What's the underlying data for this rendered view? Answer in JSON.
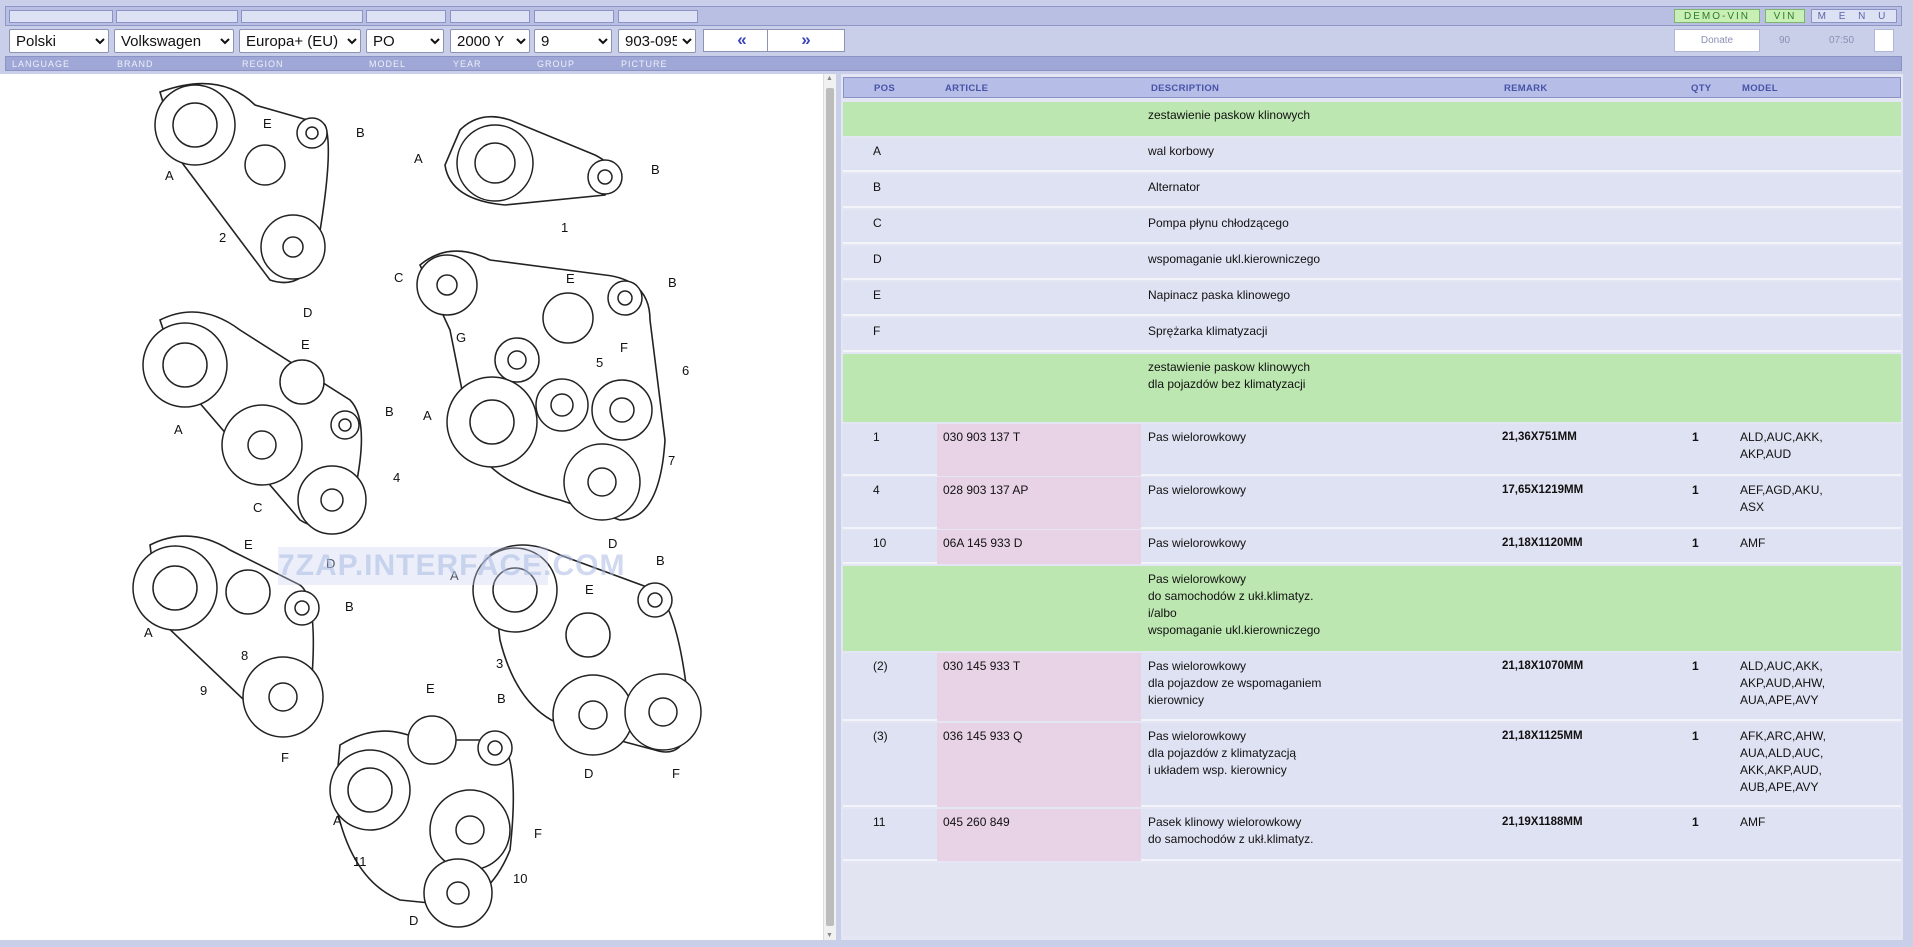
{
  "header": {
    "demo_vin": "DEMO-VIN",
    "vin": "VIN",
    "menu": "M E N U",
    "donate": "Donate",
    "counter": "90",
    "time": "07:50"
  },
  "selectors": {
    "language": "Polski",
    "brand": "Volkswagen",
    "region": "Europa+ (EU)",
    "model": "PO",
    "year": "2000  Y",
    "group": "9",
    "picture": "903-095"
  },
  "labels": {
    "language": "LANGUAGE",
    "brand": "BRAND",
    "region": "REGION",
    "model": "MODEL",
    "year": "YEAR",
    "group": "GROUP",
    "picture": "PICTURE"
  },
  "nav": {
    "prev": "«",
    "next": "»"
  },
  "watermark": "7ZAP.INTERFACE.COM",
  "table": {
    "headers": {
      "pos": "POS",
      "article": "ARTICLE",
      "description": "DESCRIPTION",
      "remark": "REMARK",
      "qty": "QTY",
      "model": "MODEL"
    },
    "rows": [
      {
        "type": "desc",
        "pos": "",
        "article": "",
        "description": "zestawienie paskow klinowych",
        "remark": "",
        "qty": "",
        "model": ""
      },
      {
        "type": "item",
        "pos": "A",
        "article": "",
        "description": "wal korbowy",
        "remark": "",
        "qty": "",
        "model": ""
      },
      {
        "type": "item",
        "pos": "B",
        "article": "",
        "description": "Alternator",
        "remark": "",
        "qty": "",
        "model": ""
      },
      {
        "type": "item",
        "pos": "C",
        "article": "",
        "description": "Pompa płynu chłodzącego",
        "remark": "",
        "qty": "",
        "model": ""
      },
      {
        "type": "item",
        "pos": "D",
        "article": "",
        "description": "wspomaganie ukl.kierowniczego",
        "remark": "",
        "qty": "",
        "model": ""
      },
      {
        "type": "item",
        "pos": "E",
        "article": "",
        "description": "Napinacz paska klinowego",
        "remark": "",
        "qty": "",
        "model": ""
      },
      {
        "type": "item",
        "pos": "F",
        "article": "",
        "description": "Sprężarka klimatyzacji",
        "remark": "",
        "qty": "",
        "model": ""
      },
      {
        "type": "desc",
        "pos": "",
        "article": "",
        "description": "zestawienie paskow klinowych\ndla pojazdów bez klimatyzacji",
        "remark": "",
        "qty": "",
        "model": ""
      },
      {
        "type": "item",
        "pos": "1",
        "article": "030 903 137 T",
        "description": "Pas wielorowkowy",
        "remark": "21,36X751MM",
        "qty": "1",
        "model": "ALD,AUC,AKK,\nAKP,AUD"
      },
      {
        "type": "item",
        "pos": "4",
        "article": "028 903 137 AP",
        "description": "Pas wielorowkowy",
        "remark": "17,65X1219MM",
        "qty": "1",
        "model": "AEF,AGD,AKU,\nASX"
      },
      {
        "type": "item",
        "pos": "10",
        "article": "06A 145 933 D",
        "description": "Pas wielorowkowy",
        "remark": "21,18X1120MM",
        "qty": "1",
        "model": "AMF"
      },
      {
        "type": "desc",
        "pos": "",
        "article": "",
        "description": "Pas wielorowkowy\ndo samochodów z ukł.klimatyz.\ni/albo\nwspomaganie ukl.kierowniczego",
        "remark": "",
        "qty": "",
        "model": ""
      },
      {
        "type": "item",
        "pos": "(2)",
        "article": "030 145 933 T",
        "description": "Pas wielorowkowy\ndla pojazdow ze wspomaganiem\nkierownicy",
        "remark": "21,18X1070MM",
        "qty": "1",
        "model": "ALD,AUC,AKK,\nAKP,AUD,AHW,\nAUA,APE,AVY"
      },
      {
        "type": "item",
        "pos": "(3)",
        "article": "036 145 933 Q",
        "description": "Pas wielorowkowy\ndla pojazdów z klimatyzacją\ni układem wsp. kierownicy",
        "remark": "21,18X1125MM",
        "qty": "1",
        "model": "AFK,ARC,AHW,\nAUA,ALD,AUC,\nAKK,AKP,AUD,\nAUB,APE,AVY"
      },
      {
        "type": "item",
        "pos": "11",
        "article": "045 260 849",
        "description": "Pasek klinowy wielorowkowy\ndo samochodów z ukł.klimatyz.",
        "remark": "21,19X1188MM",
        "qty": "1",
        "model": "AMF"
      }
    ]
  },
  "diagram": {
    "callouts": [
      "A",
      "B",
      "C",
      "D",
      "E",
      "F",
      "G",
      "1",
      "2",
      "3",
      "4",
      "5",
      "6",
      "7",
      "8",
      "9",
      "10",
      "11"
    ]
  }
}
